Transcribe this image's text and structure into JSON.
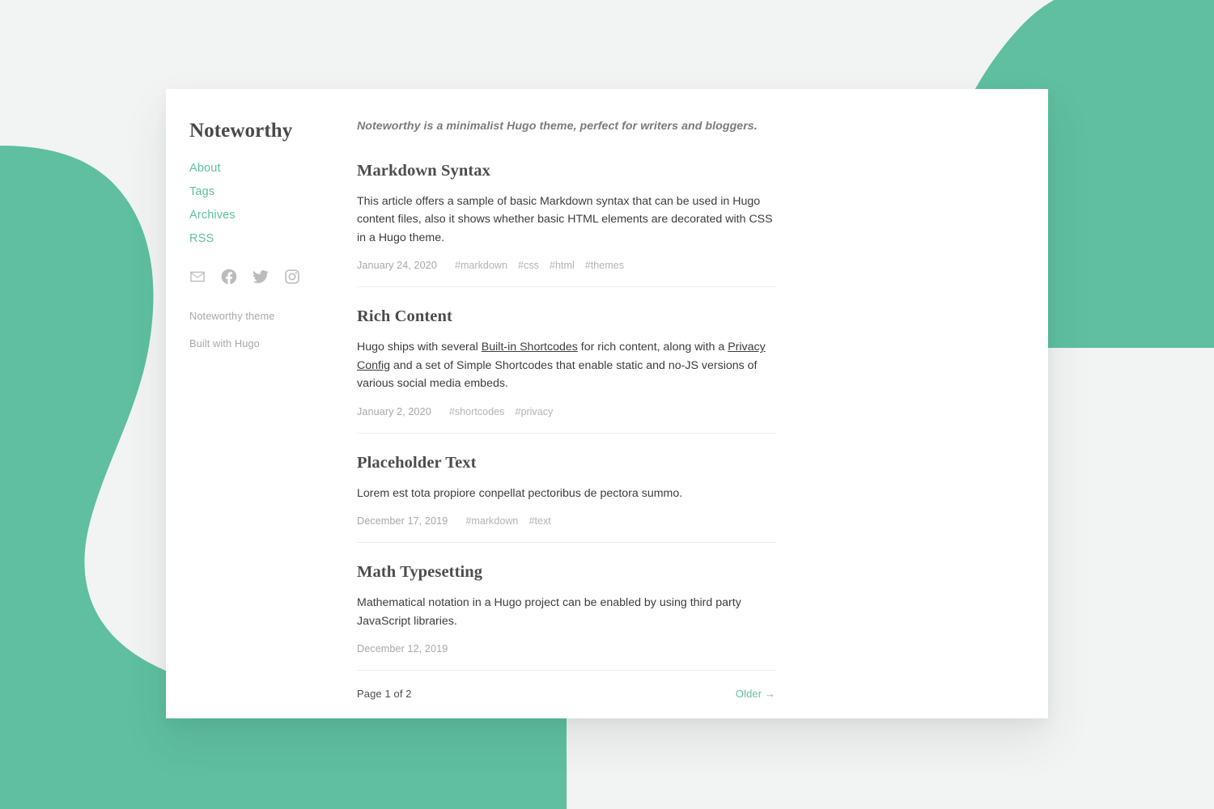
{
  "theme": {
    "accent": "#5fbfa0",
    "page_background": "#f2f4f3",
    "card_background": "#ffffff",
    "heading_color": "#4d4d4d",
    "muted_color": "#a8a8a8"
  },
  "sidebar": {
    "site_title": "Noteworthy",
    "nav": [
      {
        "label": "About",
        "name": "about"
      },
      {
        "label": "Tags",
        "name": "tags"
      },
      {
        "label": "Archives",
        "name": "archives"
      },
      {
        "label": "RSS",
        "name": "rss"
      }
    ],
    "social": [
      {
        "icon": "envelope-icon",
        "label": "Email"
      },
      {
        "icon": "facebook-icon",
        "label": "Facebook"
      },
      {
        "icon": "twitter-icon",
        "label": "Twitter"
      },
      {
        "icon": "instagram-icon",
        "label": "Instagram"
      }
    ],
    "footer": {
      "theme_credit": "Noteworthy theme",
      "built_with": "Built with Hugo"
    }
  },
  "main": {
    "tagline": "Noteworthy is a minimalist Hugo theme, perfect for writers and bloggers.",
    "posts": [
      {
        "title": "Markdown Syntax",
        "summary_parts": [
          {
            "text": "This article offers a sample of basic Markdown syntax that can be used in Hugo content files, also it shows whether basic HTML elements are decorated with CSS in a Hugo theme.",
            "link": false
          }
        ],
        "date": "January 24, 2020",
        "tags": [
          "#markdown",
          "#css",
          "#html",
          "#themes"
        ]
      },
      {
        "title": "Rich Content",
        "summary_parts": [
          {
            "text": "Hugo ships with several ",
            "link": false
          },
          {
            "text": "Built-in Shortcodes",
            "link": true
          },
          {
            "text": " for rich content, along with a ",
            "link": false
          },
          {
            "text": "Privacy Config",
            "link": true
          },
          {
            "text": " and a set of Simple Shortcodes that enable static and no-JS versions of various social media embeds.",
            "link": false
          }
        ],
        "date": "January 2, 2020",
        "tags": [
          "#shortcodes",
          "#privacy"
        ]
      },
      {
        "title": "Placeholder Text",
        "summary_parts": [
          {
            "text": "Lorem est tota propiore conpellat pectoribus de pectora summo.",
            "link": false
          }
        ],
        "date": "December 17, 2019",
        "tags": [
          "#markdown",
          "#text"
        ]
      },
      {
        "title": "Math Typesetting",
        "summary_parts": [
          {
            "text": "Mathematical notation in a Hugo project can be enabled by using third party JavaScript libraries.",
            "link": false
          }
        ],
        "date": "December 12, 2019",
        "tags": []
      }
    ],
    "pagination": {
      "indicator": "Page 1 of 2",
      "older_label": "Older →"
    }
  }
}
